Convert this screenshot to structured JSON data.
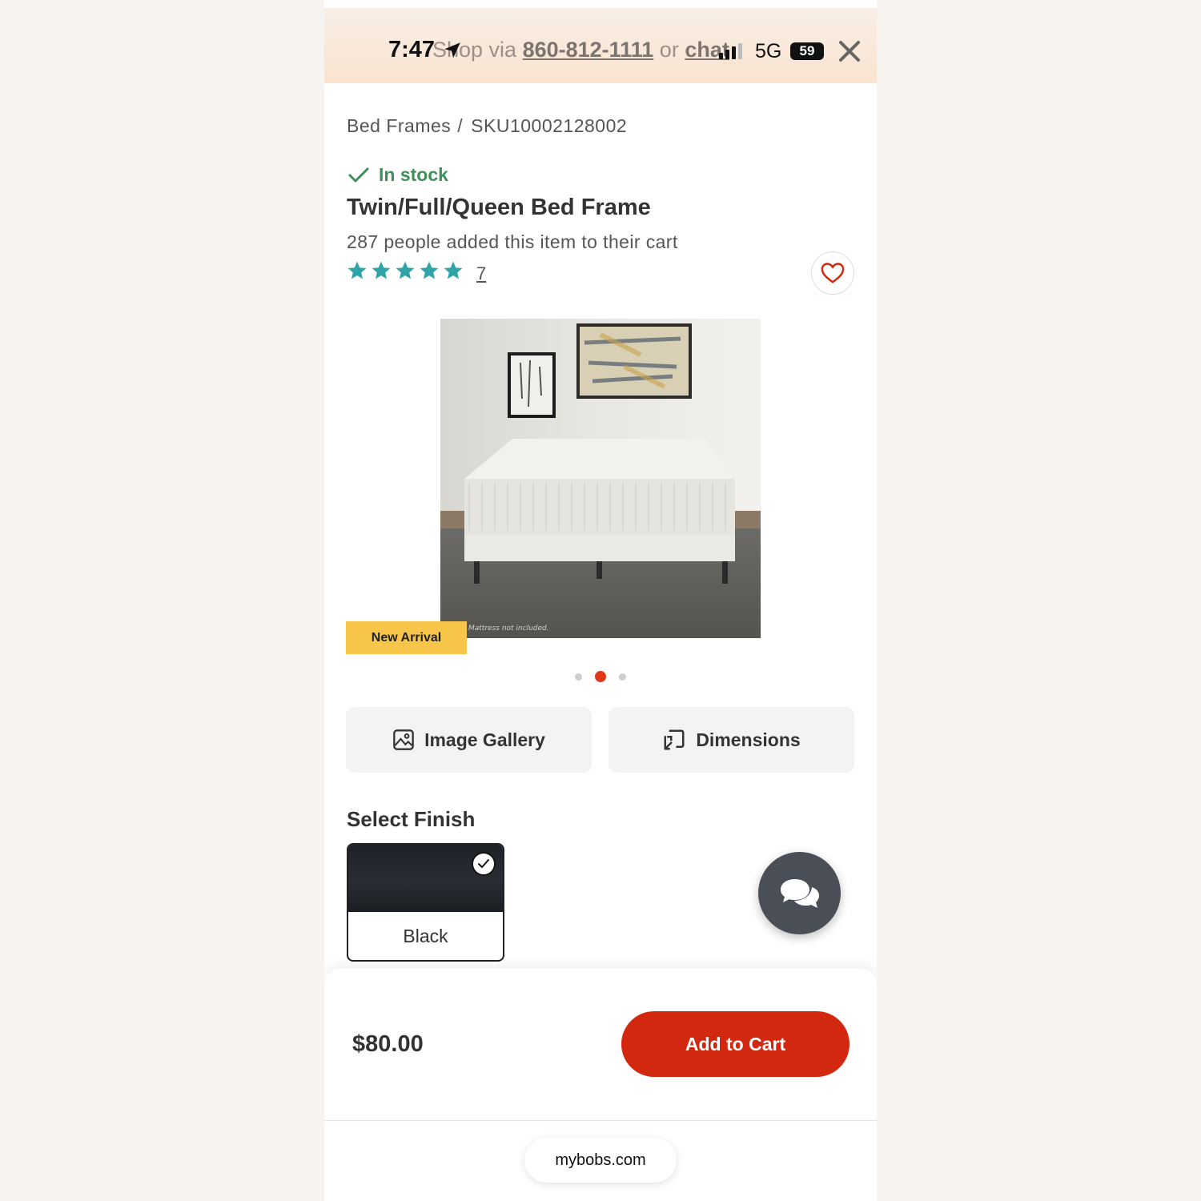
{
  "status_bar": {
    "time": "7:47",
    "network": "5G",
    "battery": "59"
  },
  "banner": {
    "text_before": "Shop via",
    "phone": "860-812-1111",
    "text_middle": "or",
    "chat_link": "chat"
  },
  "breadcrumb": {
    "category": "Bed Frames",
    "separator": "/",
    "sku": "SKU10002128002"
  },
  "product": {
    "stock_status": "In stock",
    "title": "Twin/Full/Queen Bed Frame",
    "cart_count_text": "287 people added this item to their cart",
    "rating_stars": 5,
    "review_count": "7",
    "badge": "New Arrival",
    "image_caption": "Mattress not included.",
    "carousel": {
      "total": 3,
      "active_index": 1
    }
  },
  "actions": {
    "gallery_label": "Image Gallery",
    "dimensions_label": "Dimensions"
  },
  "finish": {
    "title": "Select Finish",
    "options": [
      {
        "label": "Black",
        "selected": true
      }
    ]
  },
  "footer": {
    "price": "$80.00",
    "add_to_cart_label": "Add to Cart"
  },
  "browser": {
    "url": "mybobs.com"
  },
  "colors": {
    "accent_red": "#d2280f",
    "stock_green": "#3f8f5a",
    "star_teal": "#2ea3a8",
    "badge_yellow": "#f7c54a"
  },
  "icons": [
    "location-arrow-icon",
    "close-icon",
    "checkmark-icon",
    "star-icon",
    "heart-icon",
    "image-icon",
    "dimensions-icon",
    "chat-icon"
  ]
}
